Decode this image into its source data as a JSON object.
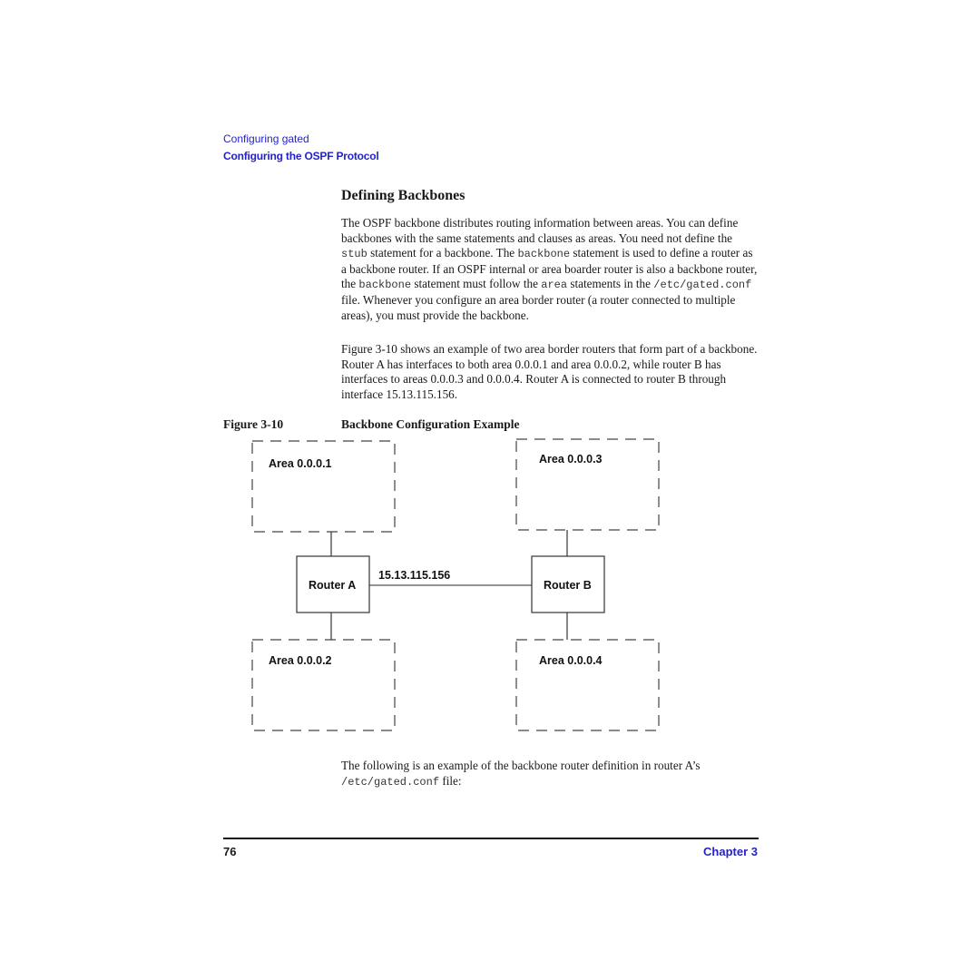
{
  "header": {
    "section": "Configuring gated",
    "subsection": "Configuring the OSPF Protocol"
  },
  "title": "Defining Backbones",
  "paragraph1": {
    "t1": "The OSPF backbone distributes routing information between areas. You can define backbones with the same statements and clauses as areas. You need not define the ",
    "c1": "stub",
    "t2": " statement for a backbone. The ",
    "c2": "backbone",
    "t3": " statement is used to define a router as a backbone router. If an OSPF internal or area boarder router is also a backbone router, the ",
    "c3": "backbone",
    "t4": " statement must follow the ",
    "c4": "area",
    "t5": " statements in the ",
    "c5": "/etc/gated.conf",
    "t6": " file. Whenever you configure an area border router (a router connected to multiple areas), you must provide the backbone."
  },
  "paragraph2": "Figure 3-10 shows an example of two area border routers that form part of a backbone. Router A has interfaces to both area 0.0.0.1 and area 0.0.0.2, while router B has interfaces to areas 0.0.0.3 and 0.0.0.4. Router A is connected to router B through interface 15.13.115.156.",
  "figure": {
    "label": "Figure 3-10",
    "title": "Backbone Configuration Example",
    "areas": [
      "Area 0.0.0.1",
      "Area 0.0.0.3",
      "Area 0.0.0.2",
      "Area 0.0.0.4"
    ],
    "routers": [
      "Router A",
      "Router B"
    ],
    "link_label": "15.13.115.156"
  },
  "paragraph3": {
    "t1": "The following is an example of the backbone router definition in router A’s ",
    "c1": "/etc/gated.conf",
    "t2": " file:"
  },
  "footer": {
    "page_number": "76",
    "chapter": "Chapter 3"
  }
}
